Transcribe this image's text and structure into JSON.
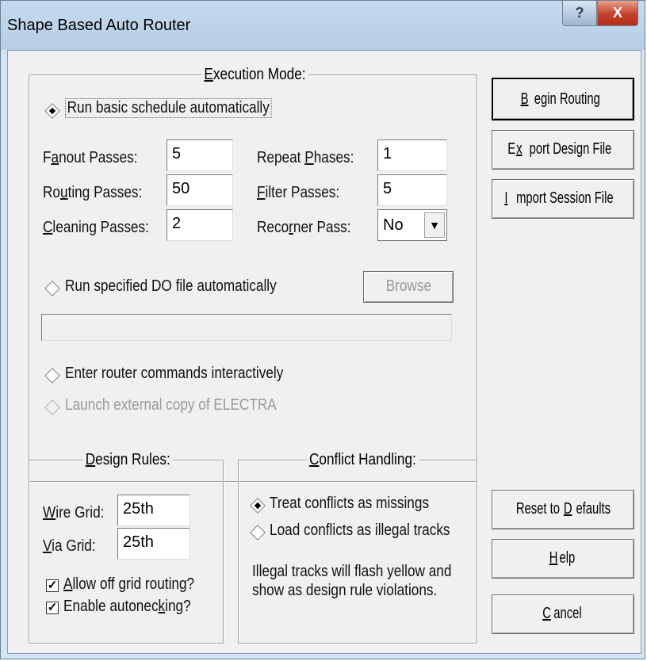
{
  "window": {
    "title": "Shape Based Auto Router",
    "help_btn": "?",
    "close_btn": "X"
  },
  "execution_mode": {
    "title_pre": "",
    "title_u": "E",
    "title_post": "xecution Mode:",
    "run_basic": "Run basic schedule automatically",
    "fanout_passes": {
      "pre": "F",
      "u": "a",
      "post": "nout Passes:",
      "value": "5"
    },
    "routing_passes": {
      "pre": "Ro",
      "u": "u",
      "post": "ting Passes:",
      "value": "50"
    },
    "cleaning_passes": {
      "pre": "",
      "u": "C",
      "post": "leaning Passes:",
      "value": "2"
    },
    "repeat_phases": {
      "pre": "Repeat ",
      "u": "P",
      "post": "hases:",
      "value": "1"
    },
    "filter_passes": {
      "pre": "",
      "u": "F",
      "post": "ilter Passes:",
      "value": "5"
    },
    "recorner_pass": {
      "pre": "Reco",
      "u": "r",
      "post": "ner Pass:",
      "value": "No"
    },
    "run_do_file": "Run specified DO file automatically",
    "browse_label": "Browse",
    "do_file_path": "",
    "enter_commands": "Enter router commands interactively",
    "launch_electra": "Launch external copy of ELECTRA"
  },
  "design_rules": {
    "title_pre": "",
    "title_u": "D",
    "title_post": "esign Rules:",
    "wire_grid": {
      "pre": "",
      "u": "W",
      "post": "ire Grid:",
      "value": "25th"
    },
    "via_grid": {
      "pre": "",
      "u": "V",
      "post": "ia Grid:",
      "value": "25th"
    },
    "allow_off_grid": {
      "pre": "",
      "u": "A",
      "post": "llow off grid routing?",
      "checked": true
    },
    "enable_autonecking": {
      "pre": "Enable autonec",
      "u": "k",
      "post": "ing?",
      "checked": true
    }
  },
  "conflict_handling": {
    "title_pre": "",
    "title_u": "C",
    "title_post": "onflict Handling:",
    "treat_missings": "Treat conflicts as missings",
    "load_illegal": "Load conflicts as illegal tracks",
    "note_line1": "Illegal tracks will flash yellow and",
    "note_line2": "show as design rule violations."
  },
  "buttons": {
    "begin_routing": {
      "pre": "",
      "u": "B",
      "post": "egin Routing"
    },
    "export_design": {
      "pre": "E",
      "u": "x",
      "post": "port Design File"
    },
    "import_session": {
      "pre": "",
      "u": "I",
      "post": "mport Session File"
    },
    "reset_defaults": {
      "pre": "Reset to ",
      "u": "D",
      "post": "efaults"
    },
    "help": {
      "pre": "",
      "u": "H",
      "post": "elp"
    },
    "cancel": {
      "pre": "",
      "u": "C",
      "post": "ancel"
    }
  },
  "colors": {
    "title_bar": "#b6cde6",
    "close_button": "#c4402a",
    "dialog_face": "#f0f0f0"
  }
}
